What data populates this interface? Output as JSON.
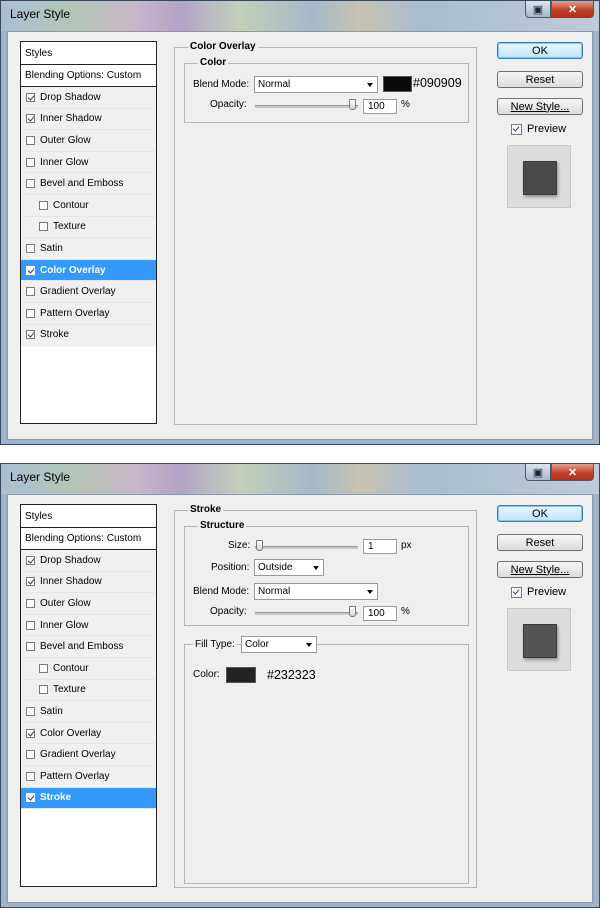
{
  "dialogs": [
    {
      "title": "Layer Style",
      "styles_header": "Styles",
      "blending_options": "Blending Options: Custom",
      "styles": [
        {
          "label": "Drop Shadow",
          "checked": true
        },
        {
          "label": "Inner Shadow",
          "checked": true
        },
        {
          "label": "Outer Glow",
          "checked": false
        },
        {
          "label": "Inner Glow",
          "checked": false
        },
        {
          "label": "Bevel and Emboss",
          "checked": false
        },
        {
          "label": "Contour",
          "checked": false
        },
        {
          "label": "Texture",
          "checked": false
        },
        {
          "label": "Satin",
          "checked": false
        },
        {
          "label": "Color Overlay",
          "checked": true
        },
        {
          "label": "Gradient Overlay",
          "checked": false
        },
        {
          "label": "Pattern Overlay",
          "checked": false
        },
        {
          "label": "Stroke",
          "checked": true
        }
      ],
      "selected": "Color Overlay",
      "panel": {
        "section_title": "Color Overlay",
        "group_title": "Color",
        "blend_mode_label": "Blend Mode:",
        "blend_mode_value": "Normal",
        "swatch_color": "#090909",
        "swatch_hex": "#090909",
        "opacity_label": "Opacity:",
        "opacity_value": "100",
        "opacity_unit": "%"
      },
      "buttons": {
        "ok": "OK",
        "reset": "Reset",
        "new_style": "New Style...",
        "preview": "Preview"
      },
      "preview_checked": true
    },
    {
      "title": "Layer Style",
      "styles_header": "Styles",
      "blending_options": "Blending Options: Custom",
      "styles": [
        {
          "label": "Drop Shadow",
          "checked": true
        },
        {
          "label": "Inner Shadow",
          "checked": true
        },
        {
          "label": "Outer Glow",
          "checked": false
        },
        {
          "label": "Inner Glow",
          "checked": false
        },
        {
          "label": "Bevel and Emboss",
          "checked": false
        },
        {
          "label": "Contour",
          "checked": false
        },
        {
          "label": "Texture",
          "checked": false
        },
        {
          "label": "Satin",
          "checked": false
        },
        {
          "label": "Color Overlay",
          "checked": true
        },
        {
          "label": "Gradient Overlay",
          "checked": false
        },
        {
          "label": "Pattern Overlay",
          "checked": false
        },
        {
          "label": "Stroke",
          "checked": true
        }
      ],
      "selected": "Stroke",
      "panel": {
        "section_title": "Stroke",
        "group_title": "Structure",
        "size_label": "Size:",
        "size_value": "1",
        "size_unit": "px",
        "position_label": "Position:",
        "position_value": "Outside",
        "blend_mode_label": "Blend Mode:",
        "blend_mode_value": "Normal",
        "opacity_label": "Opacity:",
        "opacity_value": "100",
        "opacity_unit": "%",
        "fill_type_label": "Fill Type:",
        "fill_type_value": "Color",
        "color_label": "Color:",
        "swatch_color": "#232323",
        "swatch_hex": "#232323"
      },
      "buttons": {
        "ok": "OK",
        "reset": "Reset",
        "new_style": "New Style...",
        "preview": "Preview"
      },
      "preview_checked": true
    }
  ]
}
